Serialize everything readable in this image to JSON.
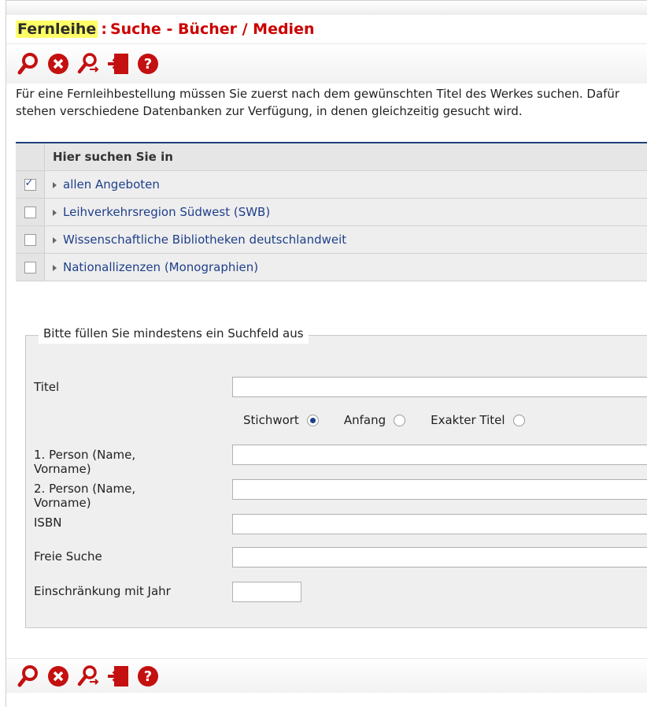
{
  "header": {
    "section": "Fernleihe",
    "separator": ":",
    "title": "Suche - Bücher / Medien"
  },
  "toolbar": {
    "icons": [
      "search-icon",
      "reset-icon",
      "refine-search-icon",
      "exit-icon",
      "help-icon"
    ]
  },
  "intro_text": "Für eine Fernleihbestellung müssen Sie zuerst nach dem gewünschten Titel des Werkes suchen. Dafür stehen verschiedene Datenbanken zur Verfügung, in denen gleichzeitig gesucht wird.",
  "databases": {
    "header": "Hier suchen Sie in",
    "items": [
      {
        "label": "allen Angeboten",
        "checked": true
      },
      {
        "label": "Leihverkehrsregion Südwest (SWB)",
        "checked": false
      },
      {
        "label": "Wissenschaftliche Bibliotheken deutschlandweit",
        "checked": false
      },
      {
        "label": "Nationallizenzen (Monographien)",
        "checked": false
      }
    ]
  },
  "form": {
    "legend": "Bitte füllen Sie mindestens ein Suchfeld aus",
    "title_label": "Titel",
    "title_value": "",
    "radio_options": [
      "Stichwort",
      "Anfang",
      "Exakter Titel"
    ],
    "radio_selected": "Stichwort",
    "person1_label": "1. Person (Name, Vorname)",
    "person1_value": "",
    "person2_label": "2. Person (Name, Vorname)",
    "person2_value": "",
    "isbn_label": "ISBN",
    "isbn_value": "",
    "free_label": "Freie Suche",
    "free_value": "",
    "year_label": "Einschränkung mit Jahr",
    "year_value": ""
  },
  "colors": {
    "title_red": "#cc0000",
    "highlight": "#ffff66",
    "link_blue": "#1f3f8a",
    "table_rule": "#1f3f7a"
  }
}
